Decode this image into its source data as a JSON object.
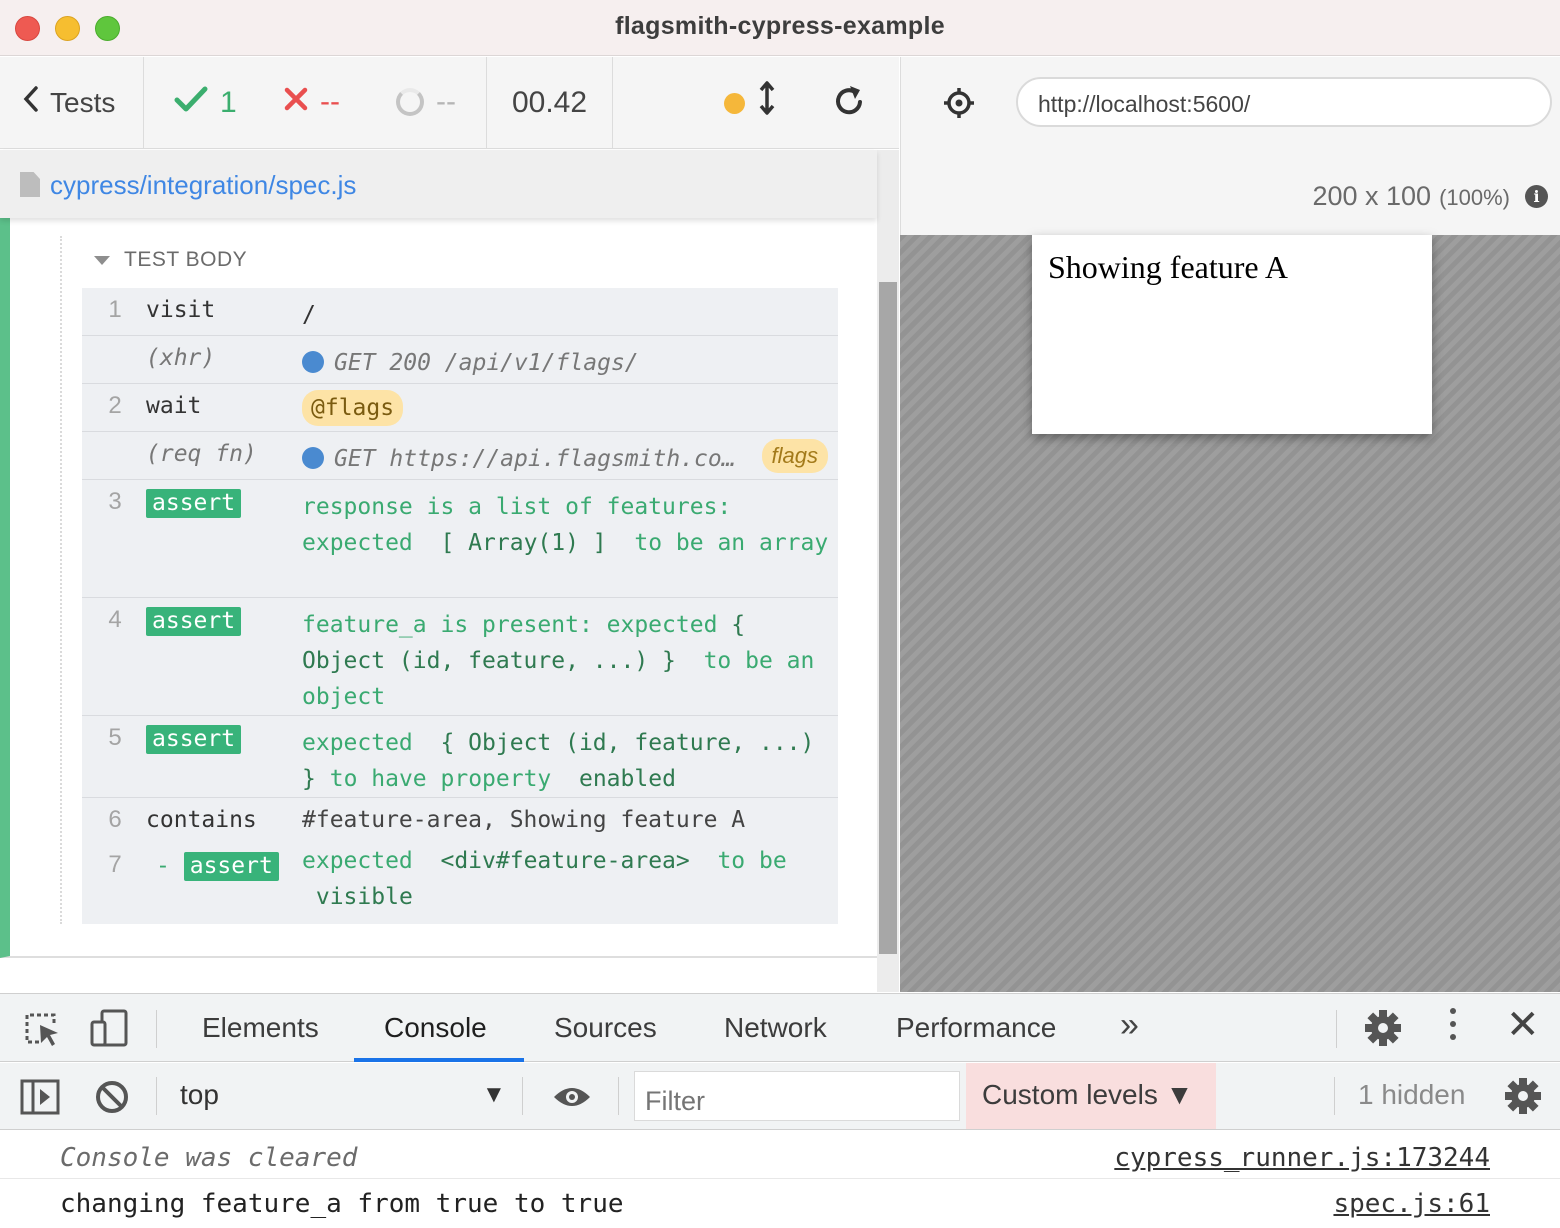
{
  "window": {
    "title": "flagsmith-cypress-example"
  },
  "reporter": {
    "tests_label": "Tests",
    "passed": "1",
    "failed": "--",
    "pending": "--",
    "duration": "00.42",
    "spec_path": "cypress/integration/spec.js",
    "section_title": "TEST BODY",
    "commands": [
      {
        "num": "1",
        "name": "visit",
        "message": "/"
      },
      {
        "num": "",
        "name": "(xhr)",
        "message": "GET 200 /api/v1/flags/"
      },
      {
        "num": "2",
        "name": "wait",
        "alias": "@flags"
      },
      {
        "num": "",
        "name": "(req fn)",
        "message": "GET https://api.flagsmith.co…",
        "badge": "flags"
      },
      {
        "num": "3",
        "name": "assert",
        "msg_a": "response is a list of features: expected",
        "msg_b": "[ Array(1) ]",
        "msg_c": "to be an array"
      },
      {
        "num": "4",
        "name": "assert",
        "msg_a": "feature_a is present: expected",
        "msg_b": "{ Object (id, feature, ...) }",
        "msg_c": "to be an object"
      },
      {
        "num": "5",
        "name": "assert",
        "msg_a": "expected",
        "msg_b": "{ Object (id, feature, ...) }",
        "msg_c": "to have property",
        "msg_d": "enabled"
      },
      {
        "num": "6",
        "name": "contains",
        "message": "#feature-area, Showing feature A"
      },
      {
        "num": "7",
        "prefix": "-",
        "name": "assert",
        "msg_a": "expected",
        "msg_b": "<div#feature-area>",
        "msg_c": "to be",
        "msg_d": "visible"
      }
    ]
  },
  "aut": {
    "url": "http://localhost:5600/",
    "viewport": "200 x 100",
    "scale": "(100%)",
    "info_icon_glyph": "i",
    "content_text": "Showing feature A"
  },
  "devtools": {
    "tabs": [
      "Elements",
      "Console",
      "Sources",
      "Network",
      "Performance"
    ],
    "active_tab": "Console",
    "more_glyph": "»",
    "close_glyph": "✕",
    "context": "top",
    "context_arrow": "▼",
    "filter_placeholder": "Filter",
    "levels_label": "Custom levels ▼",
    "hidden_label": "1 hidden",
    "messages": [
      {
        "text": "Console was cleared",
        "source": "cypress_runner.js:173244"
      },
      {
        "text": "changing feature_a from true to true",
        "source": "spec.js:61"
      }
    ]
  },
  "colors": {
    "pass": "#3bae6e",
    "fail": "#e94f4f",
    "accent_link": "#3f87e4",
    "assert_green": "#38b37a",
    "devtools_active": "#1a73e8"
  },
  "icons": [
    "chevron-left-icon",
    "check-icon",
    "x-icon",
    "pending-spinner-icon",
    "sort-arrows-icon",
    "reload-icon",
    "selector-crosshair-icon",
    "info-icon",
    "file-icon",
    "inspect-element-icon",
    "device-toggle-icon",
    "settings-gear-icon",
    "kebab-menu-icon",
    "close-icon",
    "sidebar-toggle-icon",
    "clear-console-icon",
    "eye-icon"
  ]
}
